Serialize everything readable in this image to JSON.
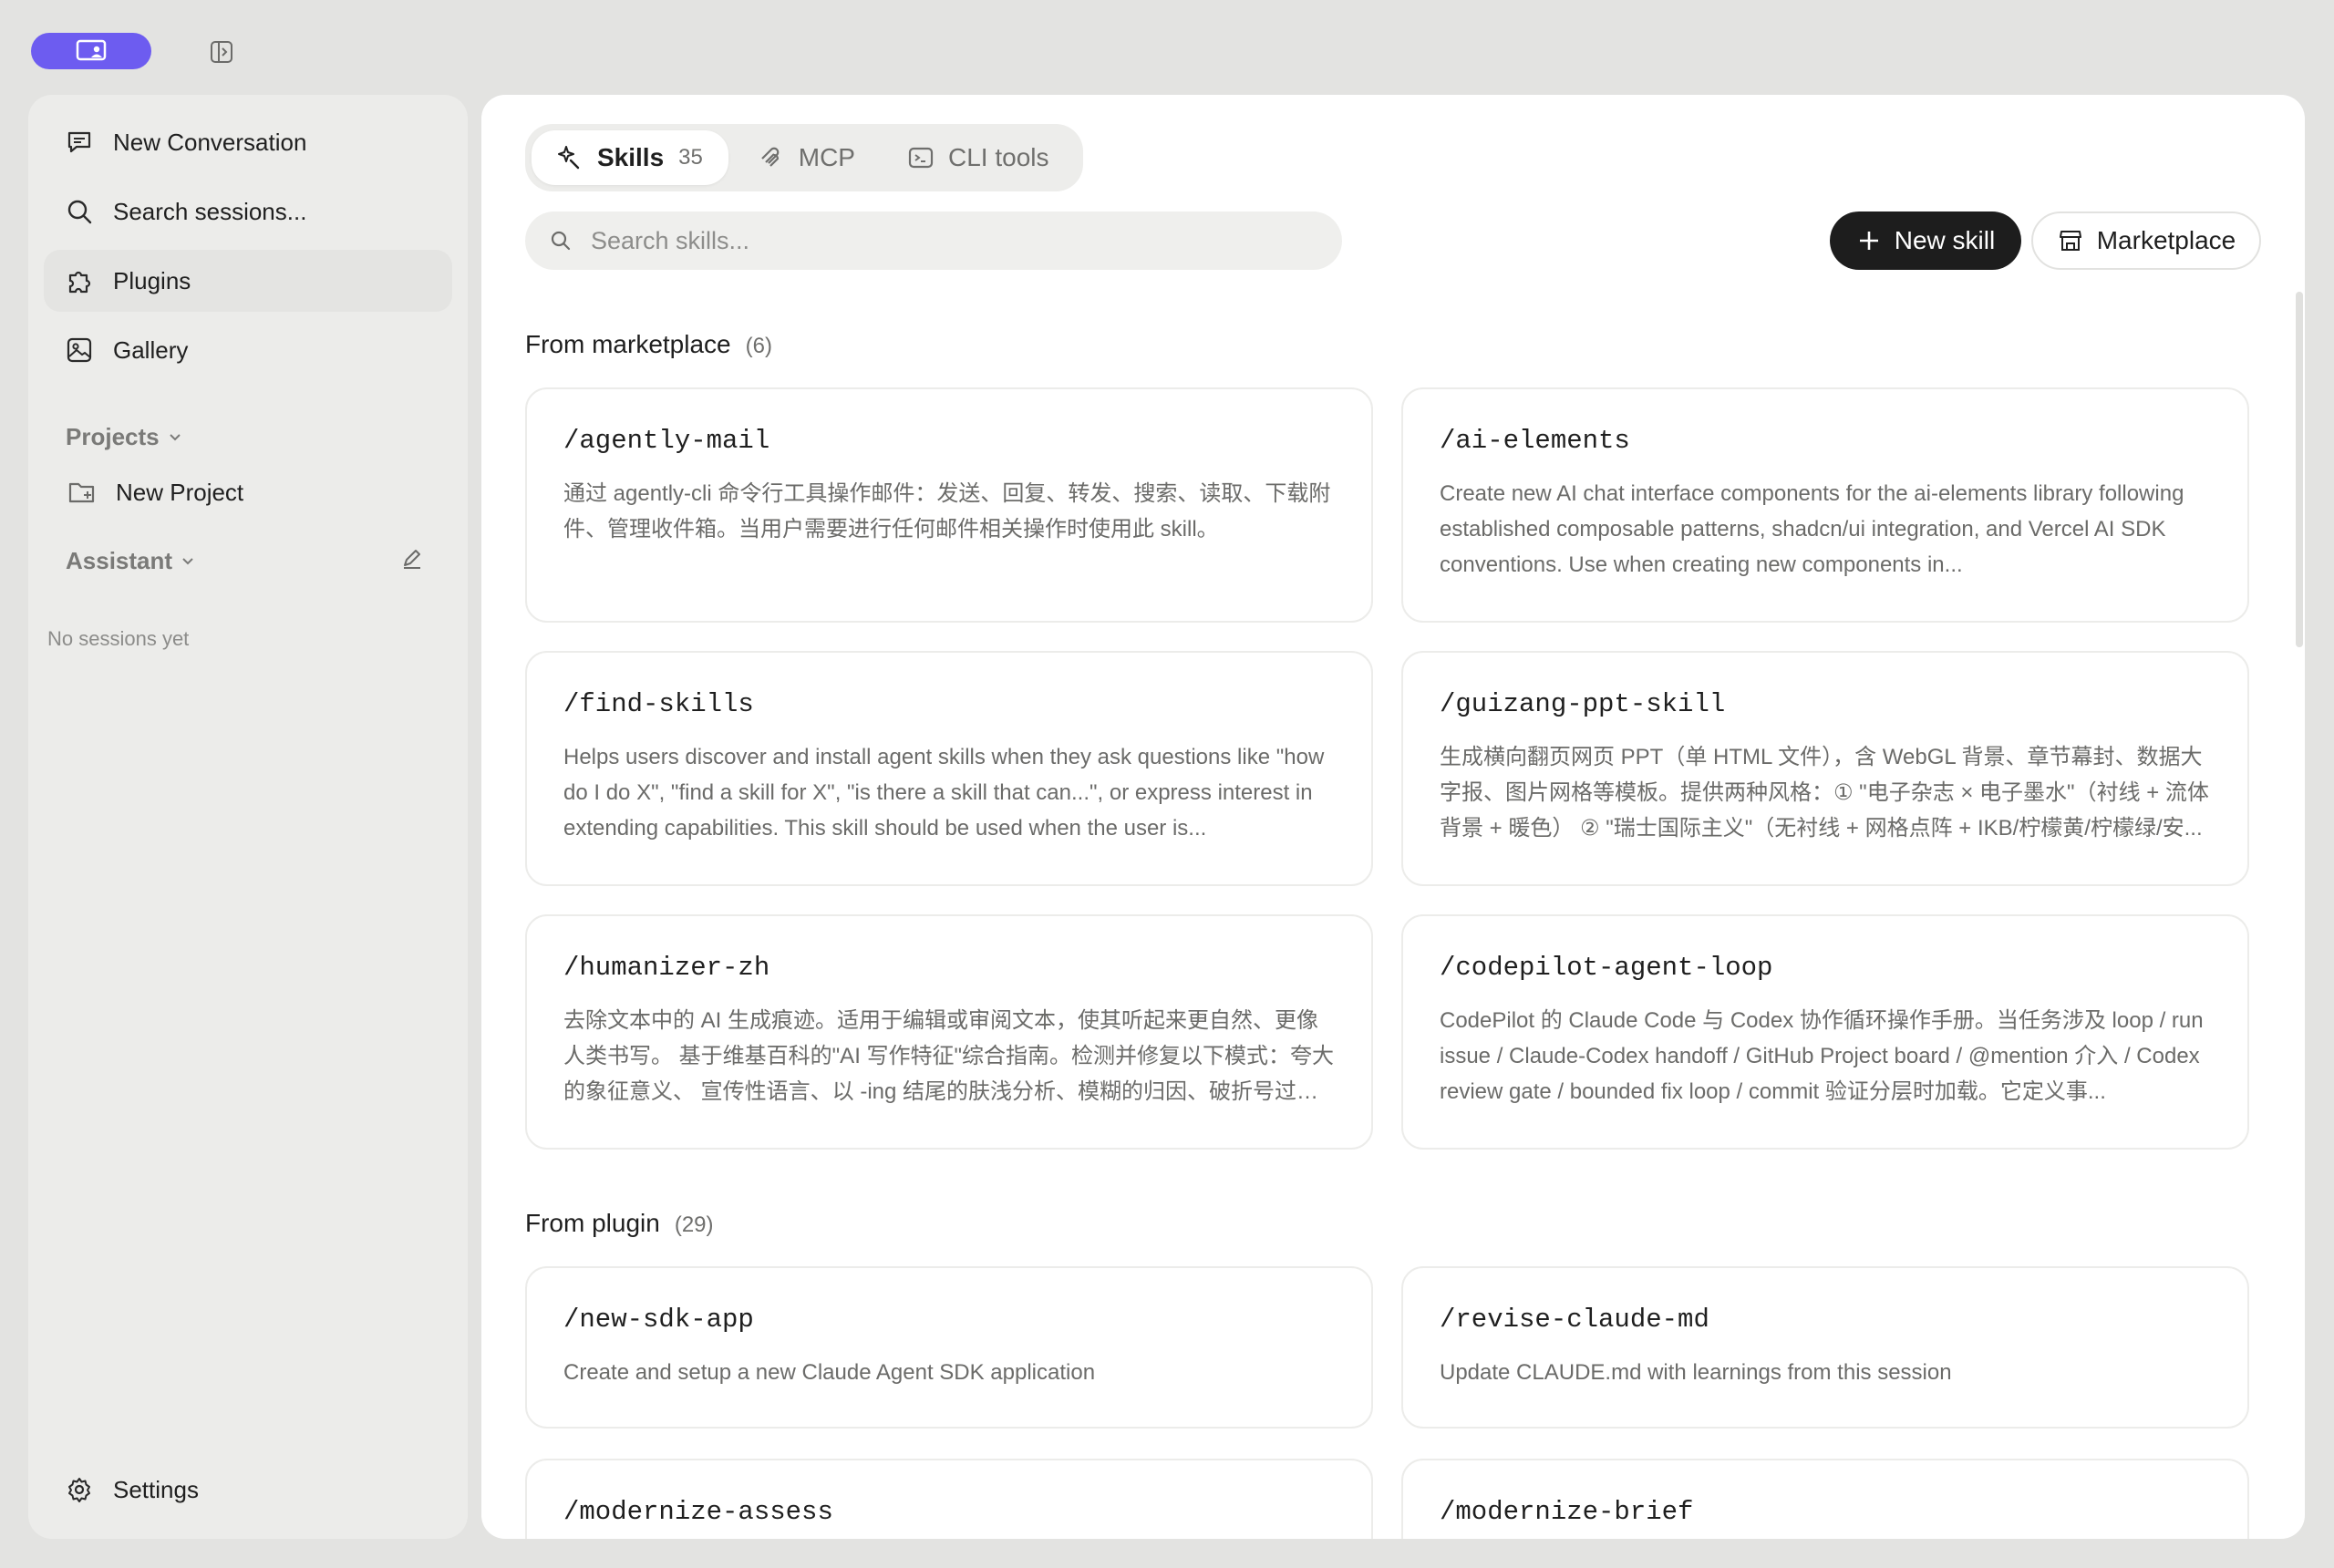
{
  "sidebar": {
    "nav": [
      {
        "label": "New Conversation",
        "icon": "message-square-icon"
      },
      {
        "label": "Search sessions...",
        "icon": "search-icon"
      },
      {
        "label": "Plugins",
        "icon": "puzzle-icon",
        "active": true
      },
      {
        "label": "Gallery",
        "icon": "image-icon"
      }
    ],
    "projects_label": "Projects",
    "new_project_label": "New Project",
    "assistant_label": "Assistant",
    "no_sessions": "No sessions yet",
    "settings_label": "Settings"
  },
  "tabs": [
    {
      "label": "Skills",
      "count": "35",
      "icon": "sparkle-icon",
      "active": true
    },
    {
      "label": "MCP",
      "icon": "mcp-icon"
    },
    {
      "label": "CLI tools",
      "icon": "terminal-icon"
    }
  ],
  "search": {
    "placeholder": "Search skills..."
  },
  "actions": {
    "new_skill": "New skill",
    "marketplace": "Marketplace"
  },
  "groups": {
    "marketplace": {
      "title": "From marketplace",
      "count": "(6)"
    },
    "plugin": {
      "title": "From plugin",
      "count": "(29)"
    }
  },
  "marketplace_skills": [
    {
      "name": "/agently-mail",
      "desc": "通过 agently-cli 命令行工具操作邮件：发送、回复、转发、搜索、读取、下载附件、管理收件箱。当用户需要进行任何邮件相关操作时使用此 skill。"
    },
    {
      "name": "/ai-elements",
      "desc": "Create new AI chat interface components for the ai-elements library following established composable patterns, shadcn/ui integration, and Vercel AI SDK conventions. Use when creating new components in..."
    },
    {
      "name": "/find-skills",
      "desc": "Helps users discover and install agent skills when they ask questions like \"how do I do X\", \"find a skill for X\", \"is there a skill that can...\", or express interest in extending capabilities. This skill should be used when the user is..."
    },
    {
      "name": "/guizang-ppt-skill",
      "desc": "生成横向翻页网页 PPT（单 HTML 文件），含 WebGL 背景、章节幕封、数据大字报、图片网格等模板。提供两种风格：① \"电子杂志 × 电子墨水\"（衬线 + 流体背景 + 暖色） ② \"瑞士国际主义\"（无衬线 + 网格点阵 + IKB/柠檬黄/柠檬绿/安..."
    },
    {
      "name": "/humanizer-zh",
      "desc": "去除文本中的 AI 生成痕迹。适用于编辑或审阅文本，使其听起来更自然、更像人类书写。 基于维基百科的\"AI 写作特征\"综合指南。检测并修复以下模式：夸大的象征意义、 宣传性语言、以 -ing 结尾的肤浅分析、模糊的归因、破折号过度..."
    },
    {
      "name": "/codepilot-agent-loop",
      "desc": "CodePilot 的 Claude Code 与 Codex 协作循环操作手册。当任务涉及 loop / run issue / Claude-Codex handoff / GitHub Project board / @mention 介入 / Codex review gate / bounded fix loop / commit 验证分层时加载。它定义事..."
    }
  ],
  "plugin_skills": [
    {
      "name": "/new-sdk-app",
      "desc": "Create and setup a new Claude Agent SDK application"
    },
    {
      "name": "/revise-claude-md",
      "desc": "Update CLAUDE.md with learnings from this session"
    },
    {
      "name": "/modernize-assess",
      "desc": ""
    },
    {
      "name": "/modernize-brief",
      "desc": ""
    }
  ],
  "colors": {
    "accent": "#6d5cf0",
    "primary_button": "#1d1d1d"
  }
}
